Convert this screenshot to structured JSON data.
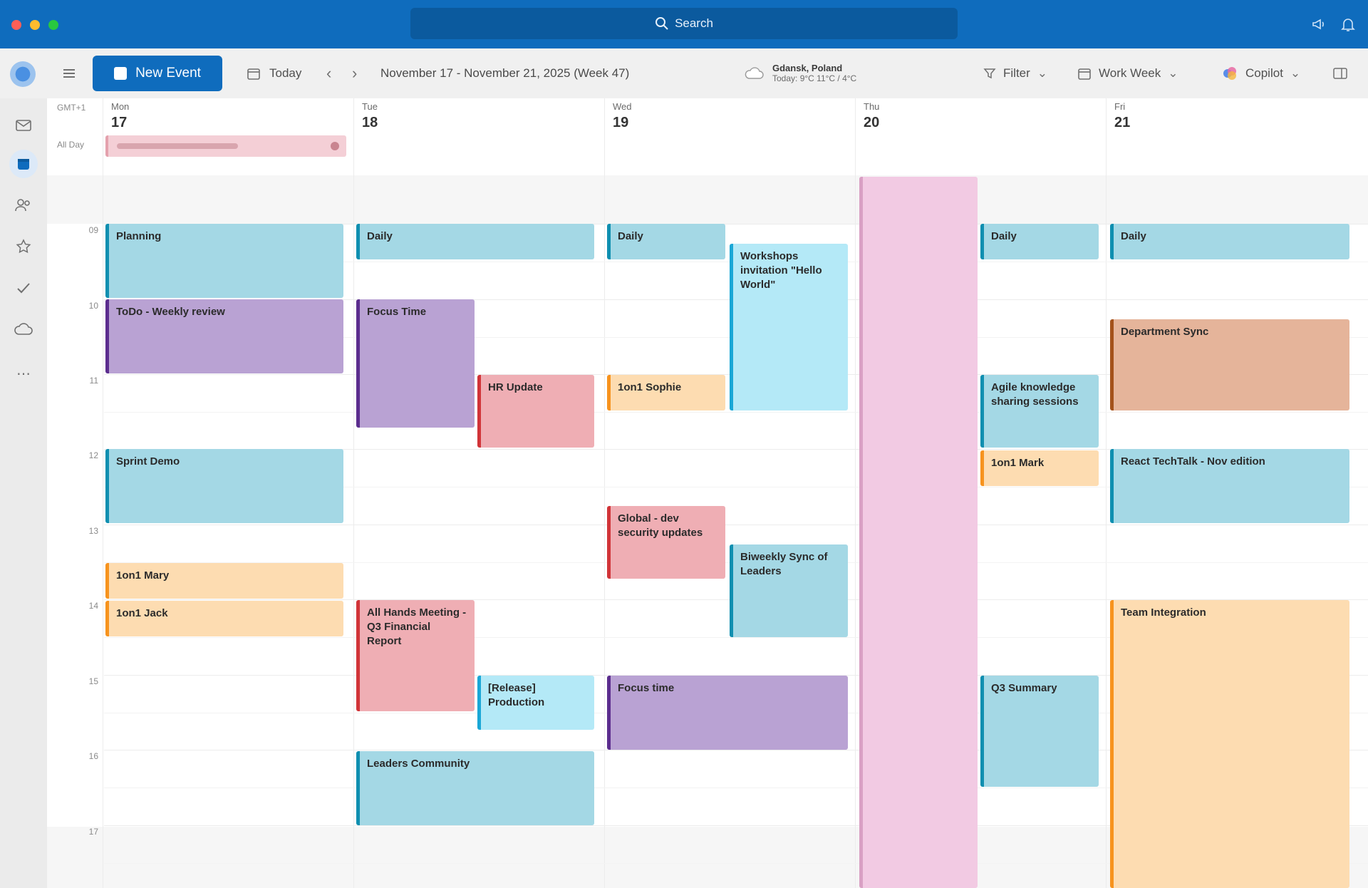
{
  "titlebar": {
    "search_label": "Search"
  },
  "toolbar": {
    "new_event": "New Event",
    "today": "Today",
    "date_range": "November 17 - November 21, 2025 (Week 47)",
    "weather_location": "Gdansk, Poland",
    "weather_detail": "Today: 9°C  11°C / 4°C",
    "filter": "Filter",
    "view": "Work Week",
    "copilot": "Copilot"
  },
  "calendar": {
    "timezone_label": "GMT+1",
    "allday_label": "All Day",
    "days": [
      {
        "name": "Mon",
        "date": "17"
      },
      {
        "name": "Tue",
        "date": "18"
      },
      {
        "name": "Wed",
        "date": "19"
      },
      {
        "name": "Thu",
        "date": "20"
      },
      {
        "name": "Fri",
        "date": "21"
      }
    ],
    "hours": [
      "09",
      "10",
      "11",
      "12",
      "13",
      "14",
      "15",
      "16",
      "17"
    ],
    "events": [
      {
        "title": "Planning",
        "color": "teal"
      },
      {
        "title": "ToDo - Weekly review",
        "color": "purple"
      },
      {
        "title": "Sprint Demo",
        "color": "teal"
      },
      {
        "title": "1on1 Mary",
        "color": "orange"
      },
      {
        "title": "1on1 Jack",
        "color": "orange"
      },
      {
        "title": "Daily",
        "color": "teal"
      },
      {
        "title": "Focus Time",
        "color": "purple"
      },
      {
        "title": "HR Update",
        "color": "pink"
      },
      {
        "title": "All Hands Meeting - Q3 Financial Report",
        "color": "pink"
      },
      {
        "title": "[Release] Production",
        "color": "cyan"
      },
      {
        "title": "Leaders Community",
        "color": "teal"
      },
      {
        "title": "Daily",
        "color": "teal"
      },
      {
        "title": "Workshops invitation \"Hello World\"",
        "color": "cyan"
      },
      {
        "title": "1on1 Sophie",
        "color": "orange"
      },
      {
        "title": "Global - dev security updates",
        "color": "pink"
      },
      {
        "title": "Biweekly Sync of Leaders",
        "color": "teal"
      },
      {
        "title": "Focus time",
        "color": "purple"
      },
      {
        "title": "Daily",
        "color": "teal"
      },
      {
        "title": "Agile knowledge sharing sessions",
        "color": "teal"
      },
      {
        "title": "1on1 Mark",
        "color": "orange"
      },
      {
        "title": "Q3 Summary",
        "color": "teal"
      },
      {
        "title": "Daily",
        "color": "teal"
      },
      {
        "title": "Department Sync",
        "color": "brown"
      },
      {
        "title": "React TechTalk - Nov edition",
        "color": "teal"
      },
      {
        "title": "Team Integration",
        "color": "orange"
      }
    ]
  }
}
